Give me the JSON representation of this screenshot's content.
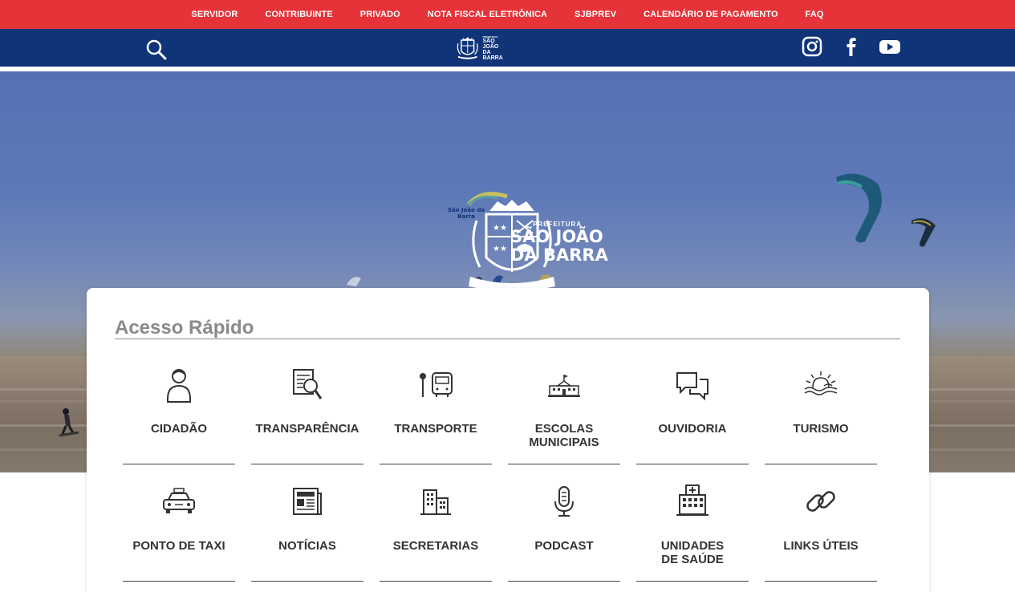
{
  "topbar": {
    "items": [
      "SERVIDOR",
      "CONTRIBUINTE",
      "PRIVADO",
      "NOTA FISCAL ELETRÔNICA",
      "SJBPREV",
      "CALENDÁRIO DE PAGAMENTO",
      "FAQ"
    ]
  },
  "navbar": {
    "logo": {
      "small": "PREFEITURA",
      "line1": "SÃO JOÃO",
      "line2": "DA BARRA"
    },
    "icons": [
      "search-icon",
      "instagram-icon",
      "facebook-icon",
      "youtube-icon"
    ]
  },
  "hero": {
    "logo": {
      "pre": "PREFEITURA",
      "line1": "SÃO JOÃO",
      "line2": "DA BARRA",
      "ribbon": "São João da Barra"
    }
  },
  "quick_access": {
    "title": "Acesso Rápido",
    "items": [
      {
        "label": "CIDADÃO",
        "icon": "citizen-icon"
      },
      {
        "label": "TRANSPARÊNCIA",
        "icon": "document-search-icon"
      },
      {
        "label": "TRANSPORTE",
        "icon": "bus-stop-icon"
      },
      {
        "label": "ESCOLAS\nMUNICIPAIS",
        "icon": "school-icon"
      },
      {
        "label": "OUVIDORIA",
        "icon": "chat-bubbles-icon"
      },
      {
        "label": "TURISMO",
        "icon": "sun-waves-icon"
      },
      {
        "label": "PONTO DE TAXI",
        "icon": "taxi-icon"
      },
      {
        "label": "NOTÍCIAS",
        "icon": "newspaper-icon"
      },
      {
        "label": "SECRETARIAS",
        "icon": "buildings-icon"
      },
      {
        "label": "PODCAST",
        "icon": "microphone-icon"
      },
      {
        "label": "UNIDADES\nDE SAÚDE",
        "icon": "hospital-icon"
      },
      {
        "label": "LINKS ÚTEIS",
        "icon": "link-icon"
      }
    ]
  },
  "colors": {
    "topbar": "#e63339",
    "navbar": "#0f3478",
    "title": "#8a8a8a",
    "label": "#333333"
  }
}
